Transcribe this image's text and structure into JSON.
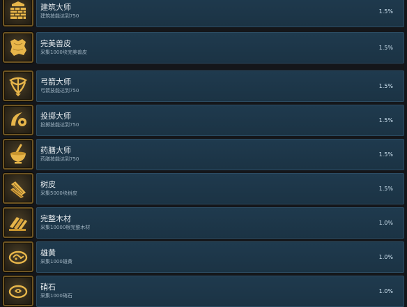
{
  "achievements": [
    {
      "title": "建筑大师",
      "description": "建筑技能达到750",
      "percent": "1.5%",
      "icon": "wall-bricks-icon"
    },
    {
      "title": "完美兽皮",
      "description": "采集1000块完美兽皮",
      "percent": "1.5%",
      "icon": "hide-pelt-icon"
    },
    {
      "title": "弓箭大师",
      "description": "弓箭技能达到750",
      "percent": "1.5%",
      "icon": "bow-icon"
    },
    {
      "title": "投掷大师",
      "description": "投掷技能达到750",
      "percent": "1.5%",
      "icon": "throw-icon"
    },
    {
      "title": "药膳大师",
      "description": "药膳技能达到750",
      "percent": "1.5%",
      "icon": "mortar-pestle-icon"
    },
    {
      "title": "树皮",
      "description": "采集5000块树皮",
      "percent": "1.5%",
      "icon": "bark-icon"
    },
    {
      "title": "完整木材",
      "description": "采集10000根完整木材",
      "percent": "1.0%",
      "icon": "lumber-icon"
    },
    {
      "title": "雄黄",
      "description": "采集1000雄黄",
      "percent": "1.0%",
      "icon": "realgar-ore-icon"
    },
    {
      "title": "硝石",
      "description": "采集1000硝石",
      "percent": "1.0%",
      "icon": "saltpeter-ore-icon"
    }
  ],
  "colors": {
    "row_background": "#1f3a4e",
    "icon_frame": "#6e5523",
    "icon_glyph": "#e8b64a"
  }
}
